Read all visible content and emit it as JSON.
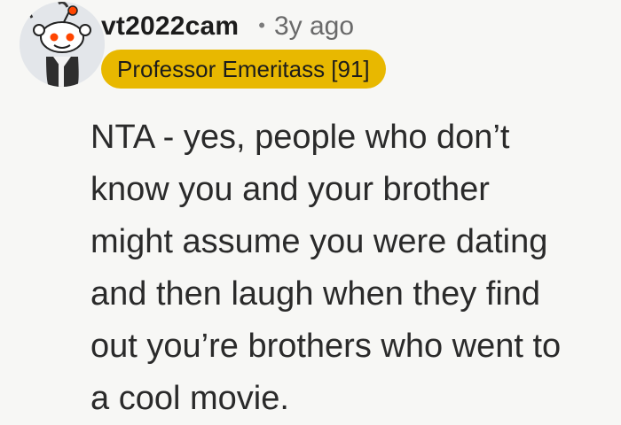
{
  "comment": {
    "author": "vt2022cam",
    "separator": "•",
    "timestamp": "3y ago",
    "flair": "Professor Emeritass [91]",
    "body_lines": [
      "NTA - yes, people who don’t",
      "know you and your brother",
      "might assume you were dating",
      "and then laugh when they find",
      "out you’re brothers who went to",
      "a cool movie."
    ]
  },
  "colors": {
    "background": "#f7f7f5",
    "flair_background": "#e8b800",
    "avatar_background": "#e3e6ea",
    "snoo_antenna_ball": "#ff4500"
  },
  "icons": {
    "avatar": "reddit-snoo-avatar-icon"
  }
}
